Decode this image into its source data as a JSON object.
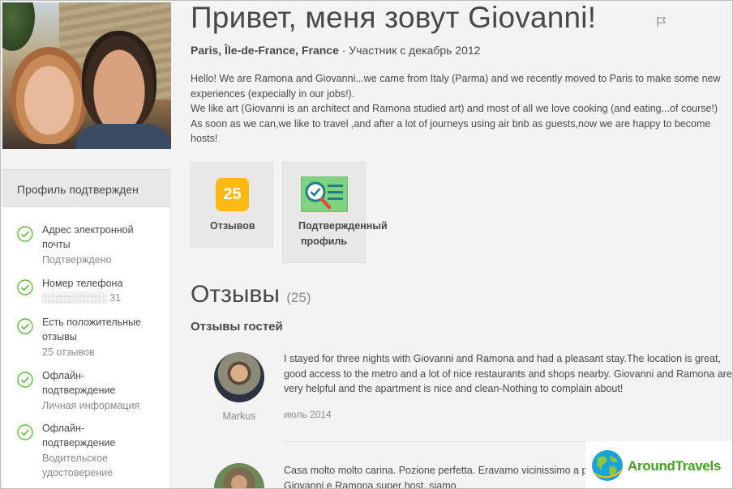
{
  "profile": {
    "title": "Привет, меня зовут Giovanni!",
    "location": "Paris, Île-de-France, France",
    "member_since": " · Участник с декабрь 2012",
    "about": [
      "Hello! We are Ramona and Giovanni...we came from Italy (Parma) and we recently moved to Paris to make some new experiences (expecially in our jobs!).",
      "We like art (Giovanni is an architect and Ramona studied art) and most of all we love cooking (and eating...of course!)",
      "As soon as we can,we like to travel ,and after a lot of journeys using air bnb as guests,now we are happy to become hosts!"
    ]
  },
  "verification": {
    "header": "Профиль подтвержден",
    "items": [
      {
        "title": "Адрес электронной почты",
        "status": "Подтверждено"
      },
      {
        "title": "Номер телефона",
        "status": "░░░░░░░░░ 31"
      },
      {
        "title": "Есть положительные отзывы",
        "status": "25 отзывов"
      },
      {
        "title": "Офлайн-подтверждение",
        "status": "Личная информация"
      },
      {
        "title": "Офлайн-подтверждение",
        "status": "Водительское удостоверение"
      }
    ],
    "check_icon": "check-circle-icon",
    "check_color": "#5bbf3a"
  },
  "badges": {
    "reviews_count": "25",
    "reviews_label": "Отзывов",
    "verified_label_line1": "Подтвержденный",
    "verified_label_line2": "профиль",
    "badge_color": "#fcb914"
  },
  "reviews": {
    "heading": "Отзывы",
    "count": "(25)",
    "guest_heading": "Отзывы гостей",
    "items": [
      {
        "author": "Markus",
        "text": "I stayed for three nights with Giovanni and Ramona and had a pleasant stay.The location is great, good access to the metro and a lot of nice restaurants and shops nearby. Giovanni and Ramona are very helpful and the apartment is nice and clean-Nothing to complain about!",
        "date": "июль 2014"
      },
      {
        "author": "",
        "text": "Casa molto molto carina. Pozione perfetta. Eravamo vicinissimo a potevamo andare ovunque. Giovanni e Ramona super host, siamo",
        "date": ""
      }
    ]
  },
  "watermark": {
    "brand": "AroundTravels",
    "brand_color": "#45a11f"
  }
}
